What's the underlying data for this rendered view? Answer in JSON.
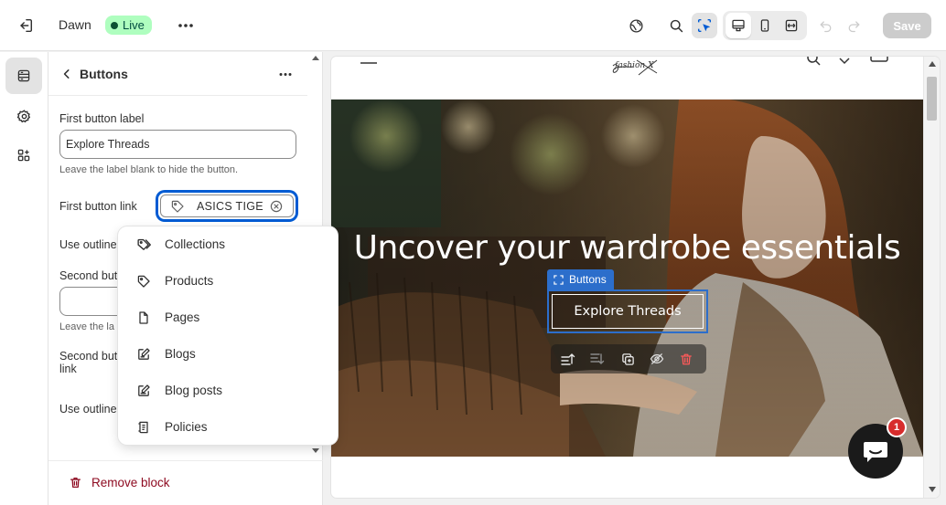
{
  "topbar": {
    "theme_name": "Dawn",
    "live_label": "Live",
    "save_label": "Save",
    "icons": [
      "exit-icon",
      "more-icon",
      "globe-icon",
      "search-icon",
      "inspector-icon",
      "desktop-icon",
      "mobile-icon",
      "fullscreen-icon",
      "undo-icon",
      "redo-icon"
    ],
    "live_color": "#affebf"
  },
  "rail": {
    "items": [
      {
        "name": "sections",
        "icon": "sections-icon",
        "active": true
      },
      {
        "name": "settings",
        "icon": "gear-icon",
        "active": false
      },
      {
        "name": "apps",
        "icon": "apps-icon",
        "active": false
      }
    ]
  },
  "panel": {
    "title": "Buttons",
    "fields": {
      "first_label_title": "First button label",
      "first_label_value": "Explore Threads",
      "first_label_help": "Leave the label blank to hide the button.",
      "first_link_title": "First button link",
      "first_link_value": "ASICS TIGE",
      "use_outline_1": "Use outline",
      "second_label_title": "Second but",
      "second_label_value": "",
      "second_help": "Leave the la",
      "second_link_title_l1": "Second but",
      "second_link_title_l2": "link",
      "use_outline_2": "Use outline"
    },
    "remove_label": "Remove block"
  },
  "dropdown": {
    "items": [
      {
        "label": "Collections",
        "icon": "tags-icon"
      },
      {
        "label": "Products",
        "icon": "tag-icon"
      },
      {
        "label": "Pages",
        "icon": "page-icon"
      },
      {
        "label": "Blogs",
        "icon": "blog-icon"
      },
      {
        "label": "Blog posts",
        "icon": "blog-post-icon"
      },
      {
        "label": "Policies",
        "icon": "policy-icon"
      }
    ]
  },
  "preview": {
    "logo_text": "fashion X",
    "heading": "Uncover your wardrobe essentials",
    "selection_label": "Buttons",
    "button_label": "Explore Threads",
    "chat_badge": "1",
    "selection_color": "#2c6ecb"
  }
}
